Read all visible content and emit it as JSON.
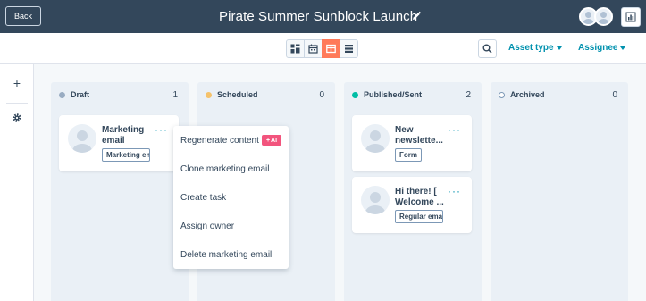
{
  "header": {
    "back_label": "Back",
    "title": "Pirate Summer Sunblock Launch"
  },
  "toolbar": {
    "views": [
      "grid-view-icon",
      "calendar-view-icon",
      "board-view-icon",
      "list-view-icon"
    ],
    "active_view": "board-view-icon",
    "asset_type_label": "Asset type",
    "assignee_label": "Assignee"
  },
  "columns": [
    {
      "name": "Draft",
      "count": "1",
      "color": "#99acc2"
    },
    {
      "name": "Scheduled",
      "count": "0",
      "color": "#f5c26b"
    },
    {
      "name": "Published/Sent",
      "count": "2",
      "color": "#00bda5"
    },
    {
      "name": "Archived",
      "count": "0",
      "color": "#ffffff"
    }
  ],
  "cards": {
    "draft": [
      {
        "title": "Marketing email",
        "tag": "Marketing email"
      }
    ],
    "published": [
      {
        "title": "New newslette...",
        "tag": "Form"
      },
      {
        "title": "Hi there! [ Welcome ...",
        "tag": "Regular email"
      }
    ]
  },
  "menu": {
    "items": [
      "Regenerate content",
      "Clone marketing email",
      "Create task",
      "Assign owner",
      "Delete marketing email"
    ],
    "ai_badge": "AI"
  },
  "colors": {
    "header_bg": "#33475b",
    "accent": "#ff7a59",
    "link": "#0091ae",
    "ai": "#f2547d"
  }
}
